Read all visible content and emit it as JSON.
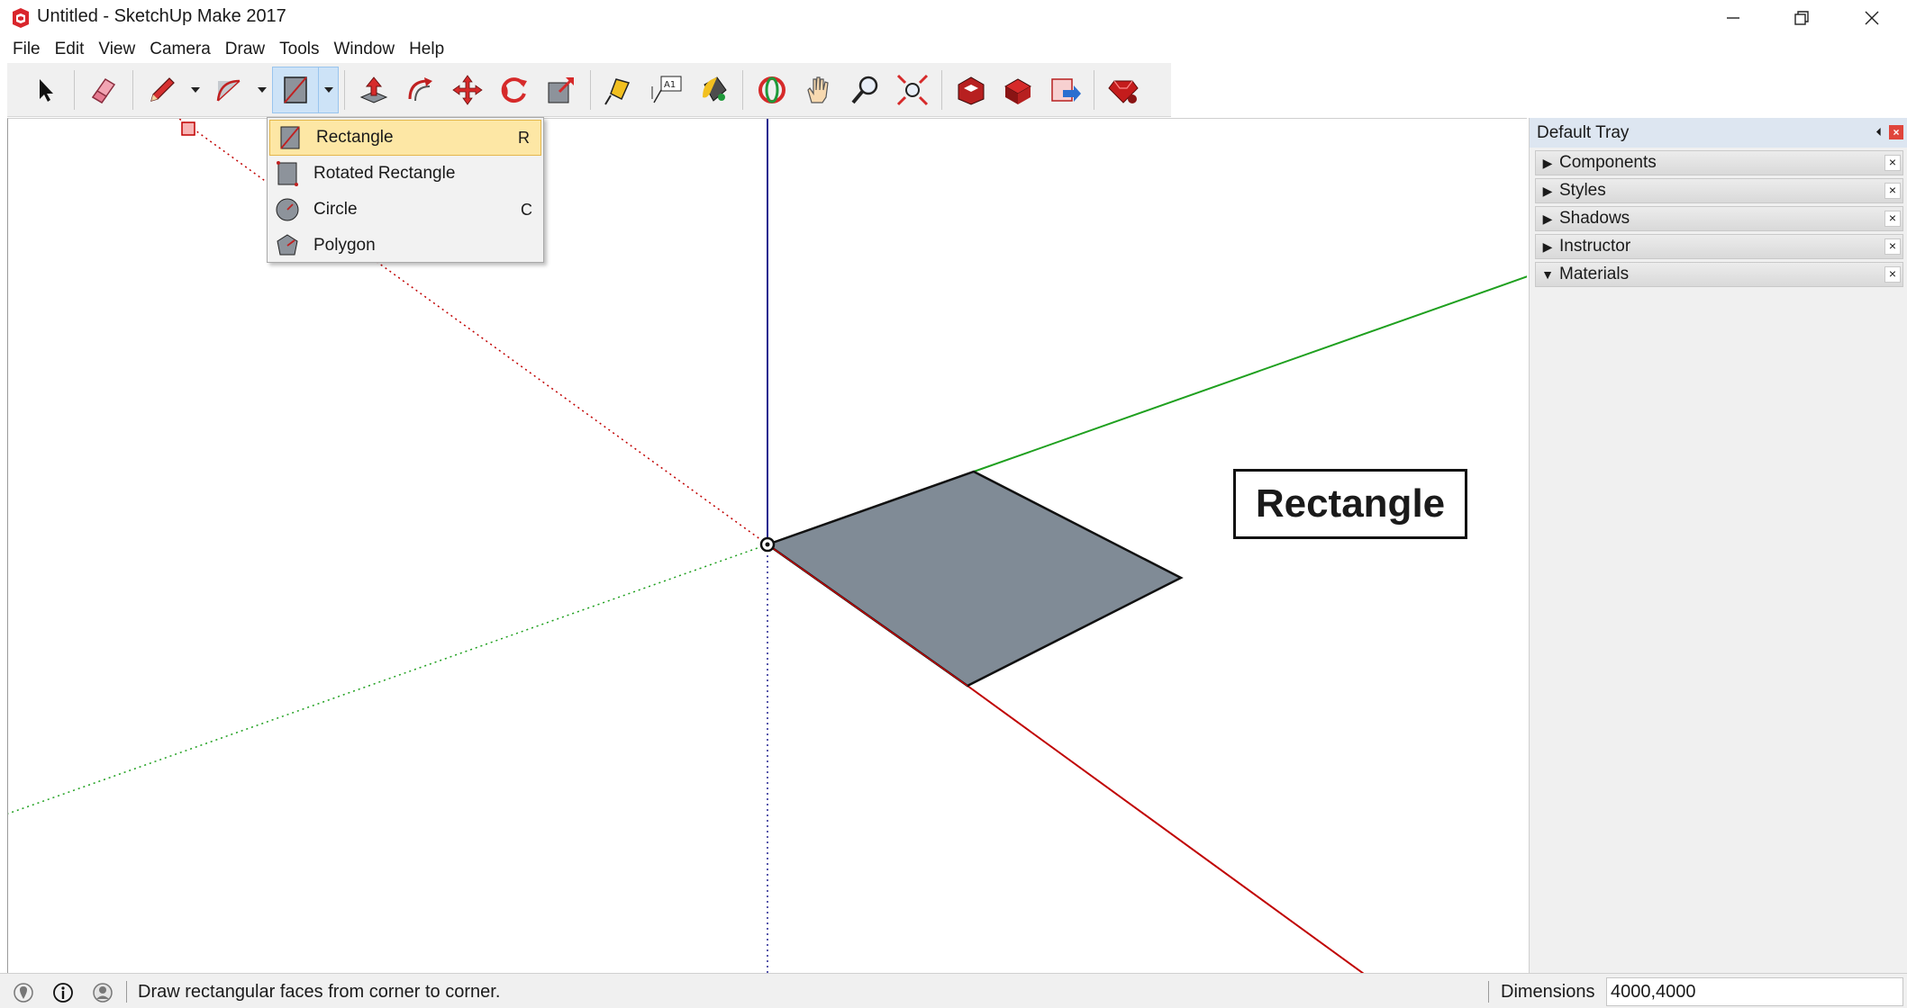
{
  "window": {
    "title": "Untitled - SketchUp Make 2017",
    "icon": "sketchup-logo-icon",
    "controls": [
      "minimize-icon",
      "restore-icon",
      "close-icon"
    ]
  },
  "menu": {
    "items": [
      "File",
      "Edit",
      "View",
      "Camera",
      "Draw",
      "Tools",
      "Window",
      "Help"
    ]
  },
  "toolbar": {
    "tools": [
      "select-icon",
      "eraser-icon",
      "pencil-icon",
      "arc-icon",
      "rectangle-icon",
      "push-pull-icon",
      "offset-icon",
      "move-icon",
      "rotate-icon",
      "scale-icon",
      "tape-measure-icon",
      "text-icon",
      "paint-bucket-icon",
      "orbit-icon",
      "pan-icon",
      "zoom-icon",
      "zoom-extents-icon",
      "warehouse-icon",
      "extension-warehouse-icon",
      "share-model-icon",
      "ruby-icon"
    ],
    "active_tool": "rectangle-icon"
  },
  "shape_menu": {
    "items": [
      {
        "label": "Rectangle",
        "shortcut": "R",
        "icon": "rectangle-icon"
      },
      {
        "label": "Rotated Rectangle",
        "shortcut": "",
        "icon": "rotated-rectangle-icon"
      },
      {
        "label": "Circle",
        "shortcut": "C",
        "icon": "circle-icon"
      },
      {
        "label": "Polygon",
        "shortcut": "",
        "icon": "polygon-icon"
      }
    ],
    "selected": "Rectangle"
  },
  "viewport": {
    "annotation_label": "Rectangle",
    "face_color": "#808b96",
    "axis_colors": {
      "red": "#c00000",
      "green": "#1fa01f",
      "blue": "#1f1f8f"
    }
  },
  "tray": {
    "title": "Default Tray",
    "panels": [
      {
        "label": "Components",
        "expanded": false
      },
      {
        "label": "Styles",
        "expanded": false
      },
      {
        "label": "Shadows",
        "expanded": false
      },
      {
        "label": "Instructor",
        "expanded": false
      },
      {
        "label": "Materials",
        "expanded": true
      }
    ]
  },
  "status": {
    "message": "Draw rectangular faces from corner to corner.",
    "dimensions_label": "Dimensions",
    "dimensions_value": "4000,4000",
    "icons": [
      "geo-location-icon",
      "credits-icon",
      "user-icon"
    ]
  }
}
